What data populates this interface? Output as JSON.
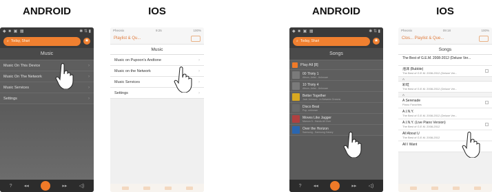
{
  "headings": [
    "ANDROID",
    "IOS",
    "ANDROID",
    "IOS"
  ],
  "phone1": {
    "search_placeholder": "Today, Shari",
    "title": "Music",
    "items": [
      "Music On This Device",
      "Music On The Network",
      "Music Services",
      "Settings"
    ]
  },
  "phone2": {
    "status_left": "Pheonix",
    "status_center": "9:25",
    "status_right": "100%",
    "back_label": "Playlist & Qu...",
    "title": "Music",
    "items": [
      "Music on Pupoon's Andtone",
      "Music on the Network",
      "Music Services",
      "Settings"
    ]
  },
  "phone3": {
    "search_placeholder": "Today, Shari",
    "title": "Songs",
    "play_all": "Play All [8]",
    "songs": [
      {
        "title": "00 Thirty 1",
        "sub": "Album, Artist - Unknown",
        "thumb_color": "#7a7a7a"
      },
      {
        "title": "10 Thirty 4",
        "sub": "Album, Artist - Unknown",
        "thumb_color": "#7a7a7a"
      },
      {
        "title": "Better Together",
        "sub": "Jack Johnson - In Between Dreams",
        "thumb_color": "#d8a820"
      },
      {
        "title": "Disco Beat",
        "sub": "Pop, unknown",
        "thumb_color": "#6a6a6a"
      },
      {
        "title": "Moves Like Jagger",
        "sub": "Maroon 5 - Hands All Over",
        "thumb_color": "#b04040"
      },
      {
        "title": "Over the Horizon",
        "sub": "Samsung - Samsung Galaxy",
        "thumb_color": "#2a66b0"
      }
    ]
  },
  "phone4": {
    "status_left": "Pheonix",
    "status_center": "09:18",
    "status_right": "100%",
    "back_label": "Clos... Playlist & Que...",
    "title": "Songs",
    "rows": [
      {
        "type": "item",
        "t1": "The Best of G.E.M. 2008-2012 (Deluxe Ver...",
        "t2": ""
      },
      {
        "type": "item",
        "t1": "泡沫 (Bubble)",
        "t2": "The Best of G.E.M. 2008-2012 (Deluxe Ver..."
      },
      {
        "type": "section",
        "t1": "A"
      },
      {
        "type": "item",
        "t1": "彩虹",
        "t2": "The Best of G.E.M. 2008-2012 (Deluxe Ver..."
      },
      {
        "type": "section",
        "t1": "A"
      },
      {
        "type": "item",
        "t1": "A Serenade",
        "t2": "Piano Favorites"
      },
      {
        "type": "item",
        "t1": "A.I.N.Y.",
        "t2": "The Best of G.E.M. 2008-2012 (Deluxe Ver..."
      },
      {
        "type": "item",
        "t1": "A.I.N.Y. (Live Piano Version)",
        "t2": "The Best of G.E.M. 2008-2012"
      },
      {
        "type": "item",
        "t1": "All About U",
        "t2": "The Best of G.E.M. 2008-2012"
      },
      {
        "type": "item",
        "t1": "All I Want",
        "t2": ""
      }
    ]
  }
}
